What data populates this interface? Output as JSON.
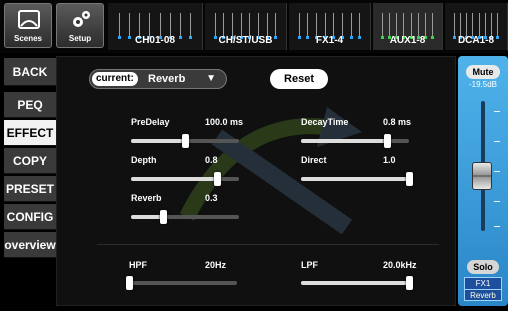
{
  "topbar": {
    "scenes_label": "Scenes",
    "setup_label": "Setup",
    "banks": [
      {
        "label": "CH01-08",
        "meter_color": "#2aa7ff",
        "active": false
      },
      {
        "label": "CH/ST/USB",
        "meter_color": "#2aa7ff",
        "active": false
      },
      {
        "label": "FX1-4",
        "meter_color": "#2aa7ff",
        "active": false
      },
      {
        "label": "AUX1-8",
        "meter_color": "#37d34a",
        "active": true
      },
      {
        "label": "DCA1-8",
        "meter_color": "#2aa7ff",
        "active": false
      }
    ]
  },
  "sidebar": {
    "items": [
      {
        "label": "BACK",
        "active": false
      },
      {
        "label": "PEQ",
        "active": false
      },
      {
        "label": "EFFECT",
        "active": true
      },
      {
        "label": "COPY",
        "active": false
      },
      {
        "label": "PRESET",
        "active": false
      },
      {
        "label": "CONFIG",
        "active": false
      },
      {
        "label": "overview",
        "active": false
      }
    ]
  },
  "main": {
    "current_label": "current:",
    "current_value": "Reverb",
    "reset_label": "Reset",
    "params": [
      {
        "name": "PreDelay",
        "value": "100.0 ms",
        "level": 0.5
      },
      {
        "name": "DecayTime",
        "value": "0.8 ms",
        "level": 0.8
      },
      {
        "name": "Depth",
        "value": "0.8",
        "level": 0.8
      },
      {
        "name": "Direct",
        "value": "1.0",
        "level": 1.0
      },
      {
        "name": "Reverb",
        "value": "0.3",
        "level": 0.3
      }
    ],
    "filters": [
      {
        "name": "HPF",
        "value": "20Hz",
        "level": 0.0
      },
      {
        "name": "LPF",
        "value": "20.0kHz",
        "level": 1.0
      }
    ]
  },
  "strip": {
    "mute_label": "Mute",
    "gain": "-19.5dB",
    "fader_level": 0.45,
    "solo_label": "Solo",
    "channel": "FX1",
    "effect": "Reverb",
    "accent": "#3fa6e3"
  }
}
